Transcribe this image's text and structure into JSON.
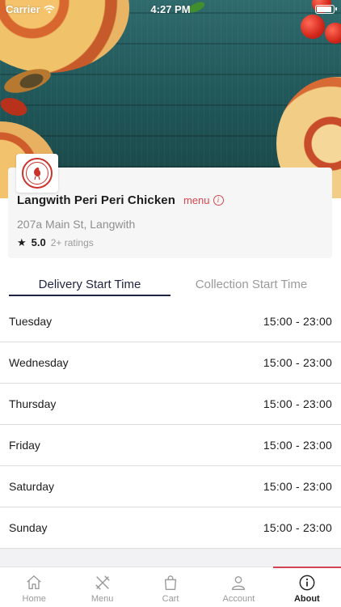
{
  "status_bar": {
    "carrier": "Carrier",
    "time": "4:27 PM"
  },
  "restaurant": {
    "name": "Langwith Peri Peri Chicken",
    "menu_link": "menu",
    "address": "207a Main St, Langwith",
    "rating": "5.0",
    "ratings_count": "2+ ratings"
  },
  "tabs": [
    {
      "label": "Delivery Start Time",
      "active": true
    },
    {
      "label": "Collection Start Time",
      "active": false
    }
  ],
  "hours": [
    {
      "day": "Tuesday",
      "time": "15:00 - 23:00"
    },
    {
      "day": "Wednesday",
      "time": "15:00 - 23:00"
    },
    {
      "day": "Thursday",
      "time": "15:00 - 23:00"
    },
    {
      "day": "Friday",
      "time": "15:00 - 23:00"
    },
    {
      "day": "Saturday",
      "time": "15:00 - 23:00"
    },
    {
      "day": "Sunday",
      "time": "15:00 - 23:00"
    }
  ],
  "tab_bar": [
    {
      "label": "Home",
      "icon": "home-icon"
    },
    {
      "label": "Menu",
      "icon": "menu-utensils-icon"
    },
    {
      "label": "Cart",
      "icon": "cart-bag-icon"
    },
    {
      "label": "Account",
      "icon": "account-person-icon"
    },
    {
      "label": "About",
      "icon": "about-info-icon",
      "active": true
    }
  ],
  "colors": {
    "accent": "#d24452",
    "tab_active": "#1f2440",
    "muted": "#9a9a9a"
  }
}
